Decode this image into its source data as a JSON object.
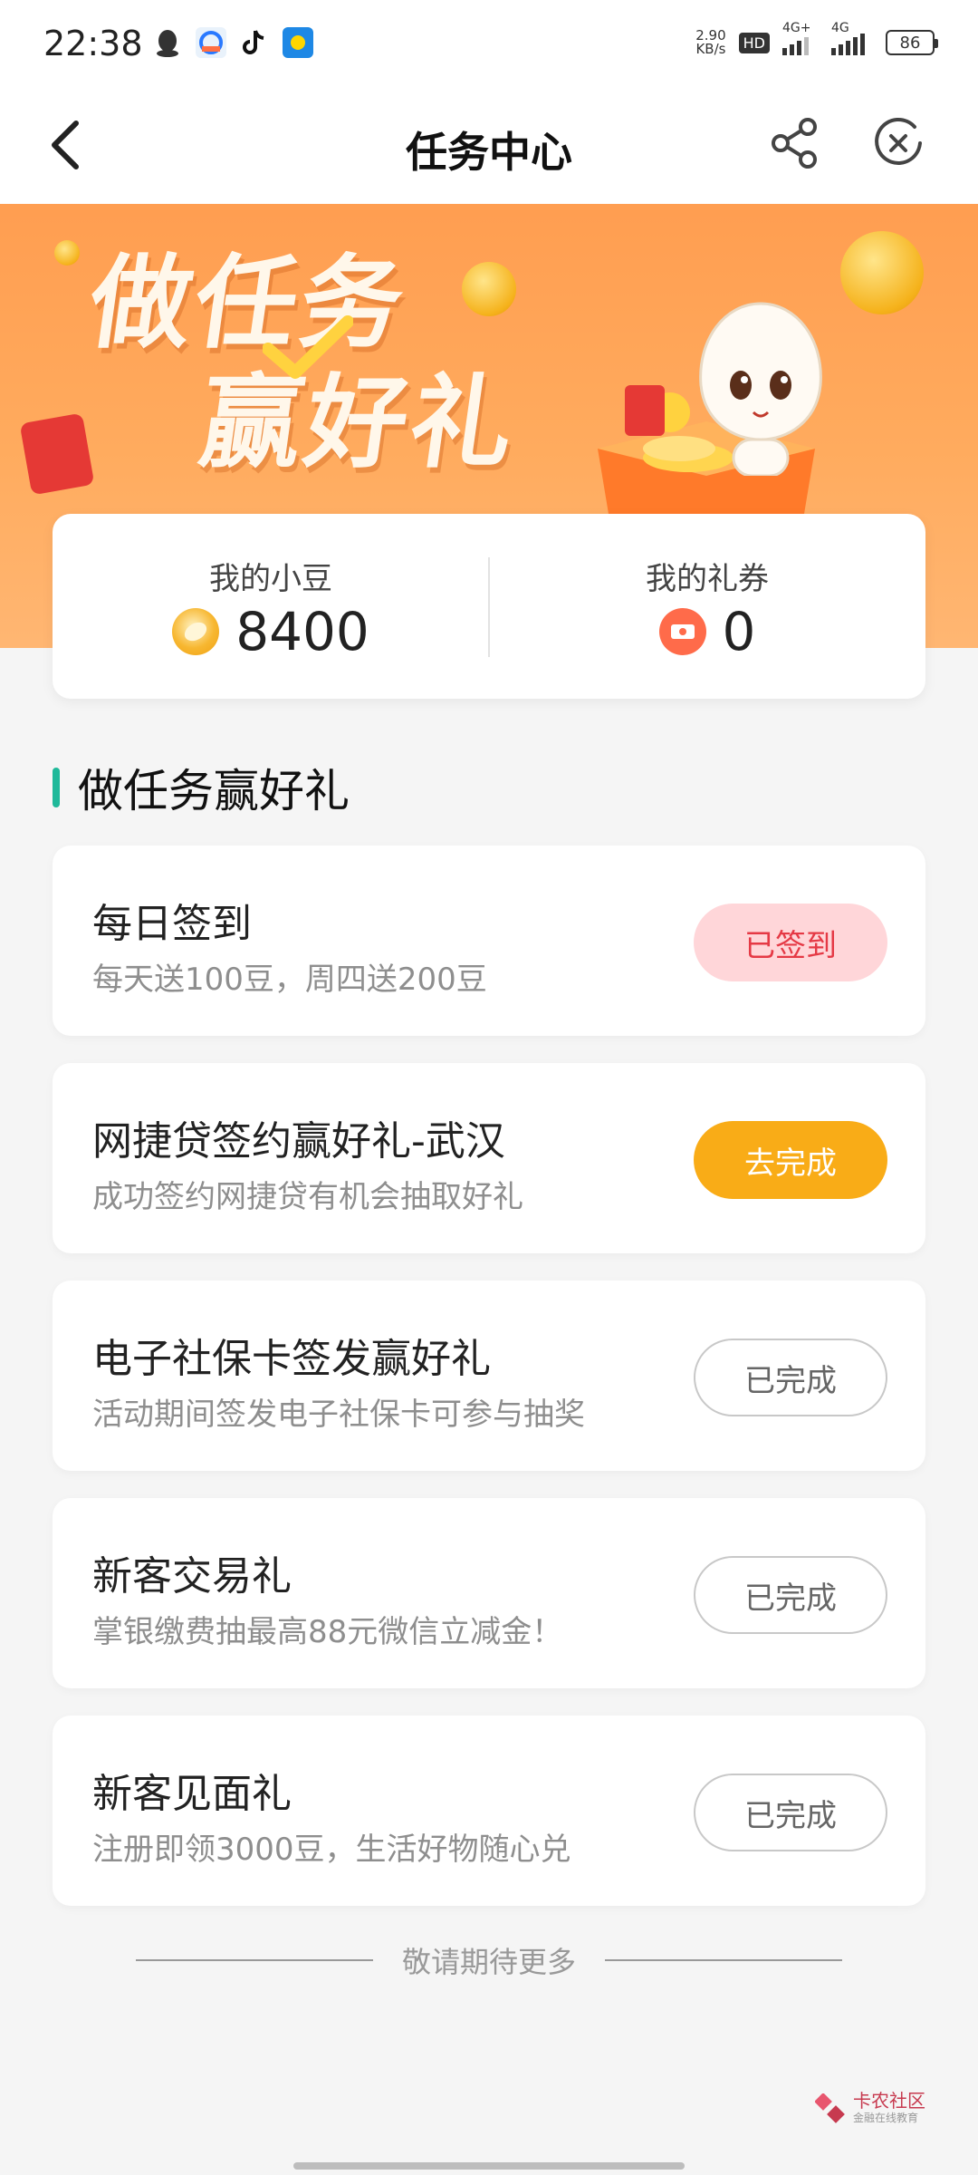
{
  "status_bar": {
    "time": "22:38",
    "net_speed_value": "2.90",
    "net_speed_unit": "KB/s",
    "hd_label": "HD",
    "signal1_label": "4G+",
    "signal2_label": "4G",
    "battery": "86"
  },
  "navbar": {
    "title": "任务中心"
  },
  "banner": {
    "headline_line1": "做任务",
    "headline_line2": "赢好礼"
  },
  "points": {
    "beans_label": "我的小豆",
    "beans_value": "8400",
    "coupons_label": "我的礼券",
    "coupons_value": "0"
  },
  "section": {
    "title": "做任务赢好礼"
  },
  "tasks": [
    {
      "title": "每日签到",
      "desc": "每天送100豆，周四送200豆",
      "button": "已签到",
      "state": "signed"
    },
    {
      "title": "网捷贷签约赢好礼-武汉",
      "desc": "成功签约网捷贷有机会抽取好礼",
      "button": "去完成",
      "state": "todo"
    },
    {
      "title": "电子社保卡签发赢好礼",
      "desc": "活动期间签发电子社保卡可参与抽奖",
      "button": "已完成",
      "state": "done"
    },
    {
      "title": "新客交易礼",
      "desc": "掌银缴费抽最高88元微信立减金！",
      "button": "已完成",
      "state": "done"
    },
    {
      "title": "新客见面礼",
      "desc": "注册即领3000豆，生活好物随心兑",
      "button": "已完成",
      "state": "done"
    }
  ],
  "footer": {
    "more_text": "敬请期待更多",
    "watermark_name": "卡农社区",
    "watermark_sub": "金融在线教育"
  },
  "colors": {
    "accent_green": "#1fb99a",
    "banner_orange": "#ff8a3d",
    "go_button": "#f9ac17",
    "signed_button_bg": "#ffd6d9",
    "signed_button_text": "#e53945"
  }
}
